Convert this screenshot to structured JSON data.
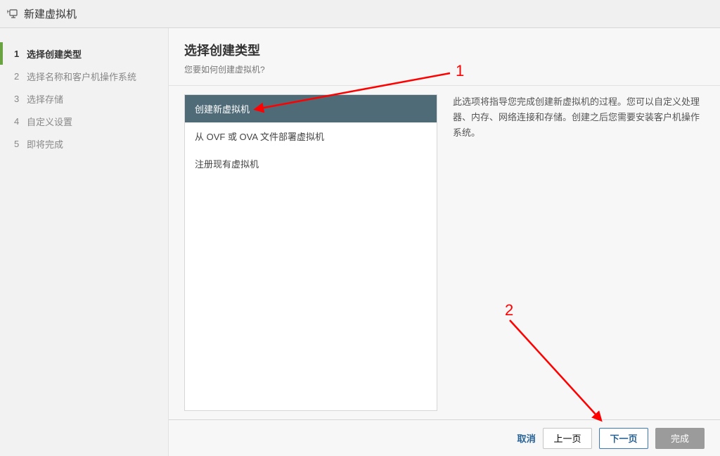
{
  "dialog": {
    "title": "新建虚拟机"
  },
  "sidebar": {
    "steps": [
      {
        "num": "1",
        "label": "选择创建类型"
      },
      {
        "num": "2",
        "label": "选择名称和客户机操作系统"
      },
      {
        "num": "3",
        "label": "选择存储"
      },
      {
        "num": "4",
        "label": "自定义设置"
      },
      {
        "num": "5",
        "label": "即将完成"
      }
    ],
    "active_index": 0
  },
  "main": {
    "heading": "选择创建类型",
    "subheading": "您要如何创建虚拟机?",
    "options": [
      "创建新虚拟机",
      "从 OVF 或 OVA 文件部署虚拟机",
      "注册现有虚拟机"
    ],
    "selected_index": 0,
    "description": "此选项将指导您完成创建新虚拟机的过程。您可以自定义处理器、内存、网络连接和存储。创建之后您需要安装客户机操作系统。"
  },
  "footer": {
    "cancel": "取消",
    "back": "上一页",
    "next": "下一页",
    "finish": "完成"
  },
  "annotations": {
    "label1": "1",
    "label2": "2"
  }
}
